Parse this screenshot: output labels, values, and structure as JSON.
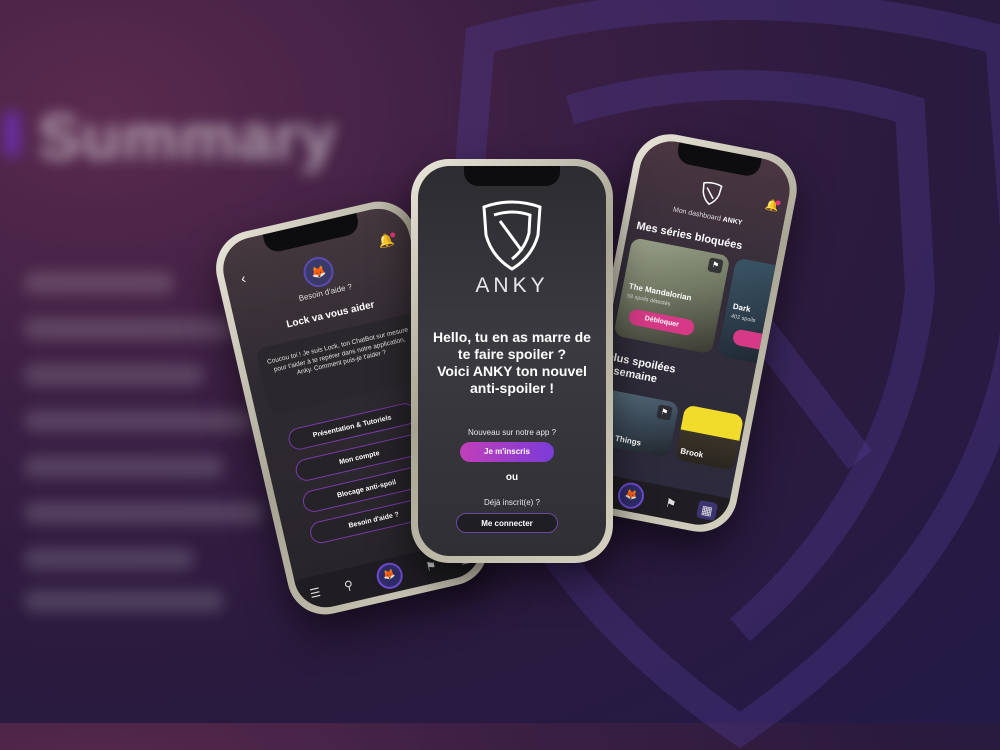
{
  "background": {
    "title": "Summary",
    "accent": "#6b2ea8"
  },
  "center": {
    "brand": "ANKY",
    "headline_line1": "Hello, tu en as marre de",
    "headline_line2": "te faire spoiler ?",
    "headline_line3": "Voici ANKY ton nouvel",
    "headline_line4": "anti-spoiler !",
    "new_question": "Nouveau sur notre app ?",
    "signup_label": "Je m'inscris",
    "or_label": "ou",
    "already_question": "Déjà inscrit(e) ?",
    "login_label": "Me connecter",
    "colors": {
      "gradient_start": "#c13fb9",
      "gradient_end": "#7b3bd8"
    }
  },
  "left": {
    "help_title": "Besoin d'aide ?",
    "bot_title": "Lock va vous aider",
    "bubble_text": "Coucou toi ! Je suis Lock, ton ChatBot sur mesure pour t'aider à te repérer dans notre application, Anky. Comment puis-je t'aider ?",
    "menu": [
      {
        "label": "Présentation & Tutoriels"
      },
      {
        "label": "Mon compte"
      },
      {
        "label": "Blocage anti-spoil"
      },
      {
        "label": "Besoin d'aide ?"
      }
    ],
    "nav_icons": [
      "menu-icon",
      "search-icon",
      "lock-avatar-icon",
      "bookmark-icon",
      "grid-icon"
    ]
  },
  "right": {
    "dashboard_prefix": "Mon dashboard",
    "dashboard_brand": "ANKY",
    "section1_title": "Mes séries bloquées",
    "card1": {
      "name": "The Mandalorian",
      "sub": "58 spoils détectés",
      "button": "Débloquer"
    },
    "card2": {
      "name": "Dark",
      "sub": "402 spoils"
    },
    "section2_line1": "plus spoilées",
    "section2_line2": "a semaine",
    "card3": {
      "name": "nger Things"
    },
    "card4": {
      "name": "Brook"
    },
    "accent": "#d63a86"
  }
}
